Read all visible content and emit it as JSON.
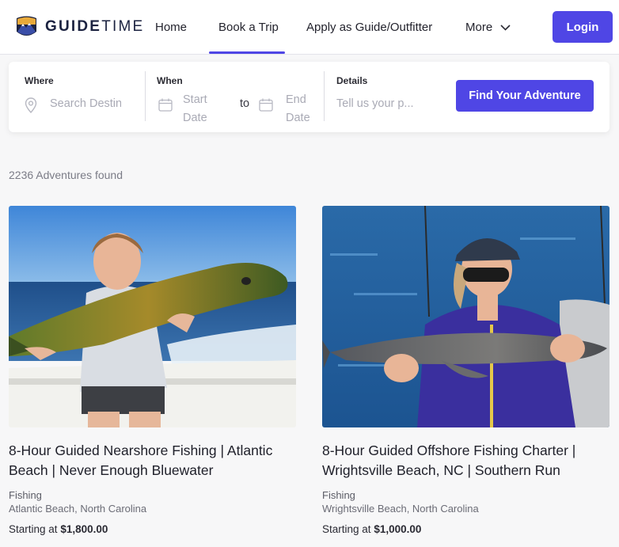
{
  "brand": {
    "logo_bold": "GUIDE",
    "logo_regular": "TIME"
  },
  "nav": {
    "home": "Home",
    "book_trip": "Book a Trip",
    "apply": "Apply as Guide/Outfitter",
    "more": "More",
    "active": "Book a Trip",
    "login": "Login"
  },
  "search": {
    "where_label": "Where",
    "where_placeholder": "Search Destination",
    "when_label": "When",
    "start_line1": "Start",
    "start_line2": "Date",
    "to": "to",
    "end_line1": "End",
    "end_line2": "Date",
    "details_label": "Details",
    "details_placeholder": "Tell us your p...",
    "button": "Find Your Adventure"
  },
  "results": {
    "count_text": "2236 Adventures found"
  },
  "cards": [
    {
      "title_line1": "8-Hour Guided Nearshore Fishing | Atlantic",
      "title_line2": "Beach | Never Enough Bluewater",
      "category": "Fishing",
      "location": "Atlantic Beach, North Carolina",
      "price_prefix": "Starting at",
      "price": "$1,800.00"
    },
    {
      "title_line1": "8-Hour Guided Offshore Fishing Charter |",
      "title_line2": "Wrightsville Beach, NC | Southern Run",
      "category": "Fishing",
      "location": "Wrightsville Beach, North Carolina",
      "price_prefix": "Starting at",
      "price": "$1,000.00"
    }
  ],
  "colors": {
    "accent": "#4f46e5",
    "logo_navy": "#1b2240",
    "logo_gold": "#e8a93a"
  }
}
